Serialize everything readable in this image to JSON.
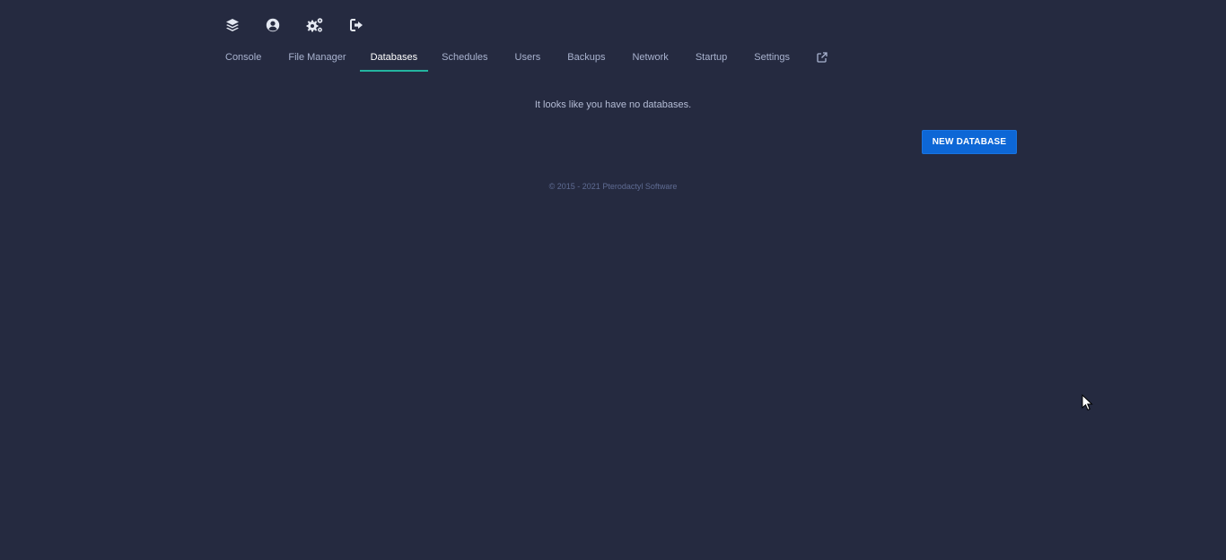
{
  "header": {
    "icons": [
      "layers-icon",
      "account-icon",
      "admin-cogs-icon",
      "sign-out-icon"
    ]
  },
  "nav": {
    "items": [
      {
        "label": "Console",
        "active": false
      },
      {
        "label": "File Manager",
        "active": false
      },
      {
        "label": "Databases",
        "active": true
      },
      {
        "label": "Schedules",
        "active": false
      },
      {
        "label": "Users",
        "active": false
      },
      {
        "label": "Backups",
        "active": false
      },
      {
        "label": "Network",
        "active": false
      },
      {
        "label": "Startup",
        "active": false
      },
      {
        "label": "Settings",
        "active": false
      }
    ],
    "external_icon": "external-link-icon"
  },
  "main": {
    "empty_message": "It looks like you have no databases.",
    "new_database_label": "NEW DATABASE"
  },
  "footer": {
    "text": "© 2015 - 2021 Pterodactyl Software"
  },
  "colors": {
    "background": "#252a40",
    "accent": "#24b4a0",
    "primary_button": "#0d67d6"
  }
}
